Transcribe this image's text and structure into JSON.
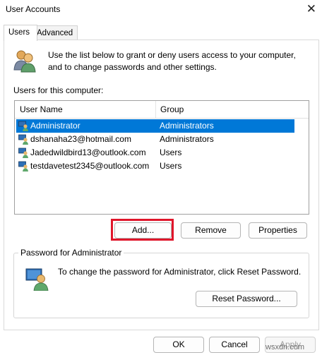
{
  "window": {
    "title": "User Accounts",
    "close_glyph": "✕"
  },
  "tabs": [
    {
      "label": "Users"
    },
    {
      "label": "Advanced"
    }
  ],
  "description": "Use the list below to grant or deny users access to your computer, and to change passwords and other settings.",
  "users_list": {
    "label": "Users for this computer:",
    "columns": [
      "User Name",
      "Group"
    ],
    "rows": [
      {
        "name": "Administrator",
        "group": "Administrators",
        "selected": true
      },
      {
        "name": "dshanaha23@hotmail.com",
        "group": "Administrators",
        "selected": false
      },
      {
        "name": "Jadedwildbird13@outlook.com",
        "group": "Users",
        "selected": false
      },
      {
        "name": "testdavetest2345@outlook.com",
        "group": "Users",
        "selected": false
      }
    ]
  },
  "buttons": {
    "add": "Add...",
    "remove": "Remove",
    "properties": "Properties"
  },
  "password_group": {
    "legend": "Password for Administrator",
    "text": "To change the password for Administrator, click Reset Password.",
    "reset_button": "Reset Password..."
  },
  "footer": {
    "ok": "OK",
    "cancel": "Cancel",
    "apply": "Apply"
  },
  "watermark": "wsxdn.com",
  "colors": {
    "selection": "#0078d7",
    "highlight_box": "#e0162b"
  },
  "icons": {
    "users": "users-icon",
    "user": "user-icon",
    "password": "user-key-icon"
  }
}
